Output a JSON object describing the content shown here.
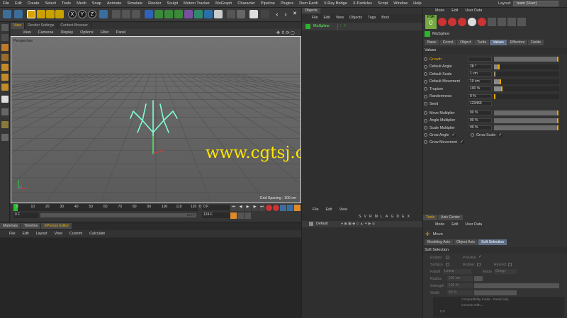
{
  "menu": [
    "File",
    "Edit",
    "Create",
    "Select",
    "Tools",
    "Mesh",
    "Snap",
    "Animate",
    "Simulate",
    "Render",
    "Sculpt",
    "Motion Tracker",
    "MoGraph",
    "Character",
    "Pipeline",
    "Plugins",
    "Dem Earth",
    "V-Ray Bridge",
    "X-Particles",
    "Script",
    "Window",
    "Help"
  ],
  "layout": {
    "label": "Layout:",
    "value": "team (User)"
  },
  "viewport": {
    "tabs": [
      "View",
      "Render Settings",
      "Content Browser"
    ],
    "menu": [
      "View",
      "Cameras",
      "Display",
      "Options",
      "Filter",
      "Panel"
    ],
    "label": "Perspective",
    "grid_spacing": "Grid Spacing : 100 cm"
  },
  "timeline": {
    "ticks": [
      "0",
      "10",
      "20",
      "30",
      "40",
      "50",
      "60",
      "70",
      "80",
      "90",
      "100",
      "110",
      "120"
    ],
    "current": "0 F",
    "start": "0 F",
    "end_a": "124 F",
    "end_b": "124 F",
    "frame_field": "0 F",
    "end_field": "124 F"
  },
  "objects": {
    "tab": "Objects",
    "menu": [
      "File",
      "Edit",
      "View",
      "Objects",
      "Tags",
      "Bool"
    ],
    "items": [
      {
        "name": "MoSpline"
      }
    ]
  },
  "attributes": {
    "header_menu": [
      "Mode",
      "Edit",
      "User Data"
    ],
    "psr_label": "PSR",
    "psr_value": "0",
    "object_name": "MoSpline",
    "tabs": [
      "Basic",
      "Coord.",
      "Object",
      "Turtle",
      "Values",
      "Effectors",
      "Fields"
    ],
    "active_tab": "Values",
    "section": "Values",
    "params": [
      {
        "label": "Growth",
        "value": "",
        "fill": 0.98,
        "accent": true
      },
      {
        "label": "Default Angle",
        "value": "28 °",
        "fill": 0.08
      },
      {
        "label": "Default Scale",
        "value": "1 cm",
        "fill": 0.02
      },
      {
        "label": "Default Movement",
        "value": "10 cm",
        "fill": 0.1
      },
      {
        "label": "Tropism",
        "value": "100 %",
        "fill": 0.12
      },
      {
        "label": "Randomness",
        "value": "0 %",
        "fill": 0
      },
      {
        "label": "Seed",
        "value": "123456",
        "fill": null
      }
    ],
    "multipliers": [
      {
        "label": "Move Multiplier",
        "value": "90 %",
        "fill": 0.98
      },
      {
        "label": "Angle Multiplier",
        "value": "90 %",
        "fill": 0.98
      },
      {
        "label": "Scale Multiplier",
        "value": "90 %",
        "fill": 0.98
      }
    ],
    "checks": [
      {
        "label": "Grow Angle",
        "checked": true
      },
      {
        "label": "Grow Scale",
        "checked": true
      },
      {
        "label": "Grow Movement",
        "checked": true
      }
    ]
  },
  "materials": {
    "tabs": [
      "Materials",
      "Timeline",
      "XPresso Editor"
    ],
    "active": "XPresso Editor",
    "menu": [
      "File",
      "Edit",
      "Layout",
      "View",
      "Custom",
      "Calculate"
    ]
  },
  "layers": {
    "menu": [
      "File",
      "Edit",
      "View"
    ],
    "columns": [
      "S",
      "V",
      "R",
      "M",
      "L",
      "A",
      "G",
      "D",
      "E",
      "X"
    ],
    "items": [
      {
        "name": "Default"
      }
    ]
  },
  "tools": {
    "tabs": [
      "Tools",
      "Axis Center"
    ],
    "header_menu": [
      "Mode",
      "Edit",
      "User Data"
    ],
    "tool_name": "Move",
    "subtabs": [
      "Modeling Axis",
      "Object Axis",
      "Soft Selection"
    ],
    "active_subtab": "Soft Selection",
    "section": "Soft Selection",
    "fields": {
      "enable": "Enable",
      "preview": "Preview",
      "surface": "Surface",
      "rubber": "Rubber",
      "restrict": "Restrict",
      "falloff": "Falloff",
      "falloff_value": "Linear",
      "mode": "Mode",
      "mode_value": "Group",
      "radius": "Radius",
      "radius_value": "100 cm",
      "strength": "Strength",
      "strength_value": "100 %",
      "width": "Width",
      "width_value": "50 %"
    },
    "note_line1": "Compatibility mode - Read only",
    "note_line2": "Convert with ...",
    "bottom_value": "0.5"
  },
  "watermark": "www.cgtsj.com",
  "colors": {
    "accent": "#e8a800",
    "selected_tab": "#5f6f86",
    "watermark": "#ffe600",
    "spline": "#7fffd4"
  }
}
